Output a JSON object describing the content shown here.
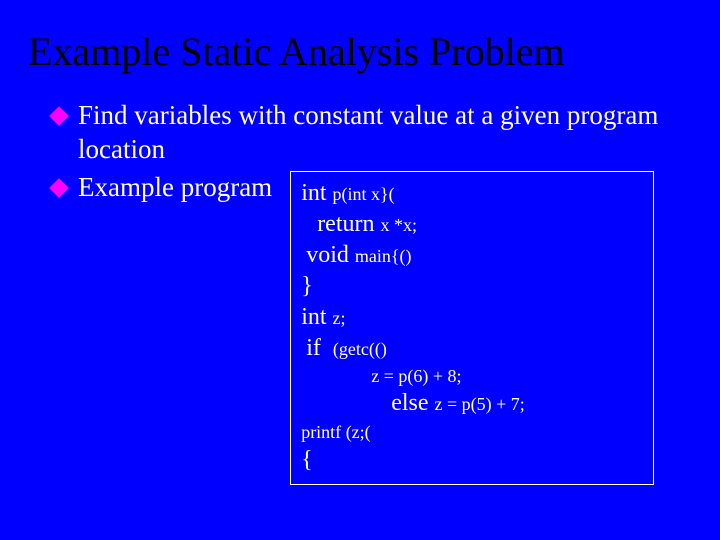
{
  "title": "Example Static Analysis Problem",
  "bullets": [
    "Find variables with constant value at a given program location",
    "Example program"
  ],
  "code": {
    "l1a": "int ",
    "l1b": "p(int x}(",
    "l2a": "return ",
    "l2b": "x *x;",
    "l3a": "void ",
    "l3b": "main{()",
    "l4": "}",
    "l5a": "int ",
    "l5b": "z;",
    "l6a": "if  ",
    "l6b": "(getc(()",
    "l7": "z = p(6) + 8;",
    "l8a": "else ",
    "l8b": "z = p(5) + 7;",
    "l9a": "printf ",
    "l9b": "(z;(",
    "l10": "{"
  }
}
